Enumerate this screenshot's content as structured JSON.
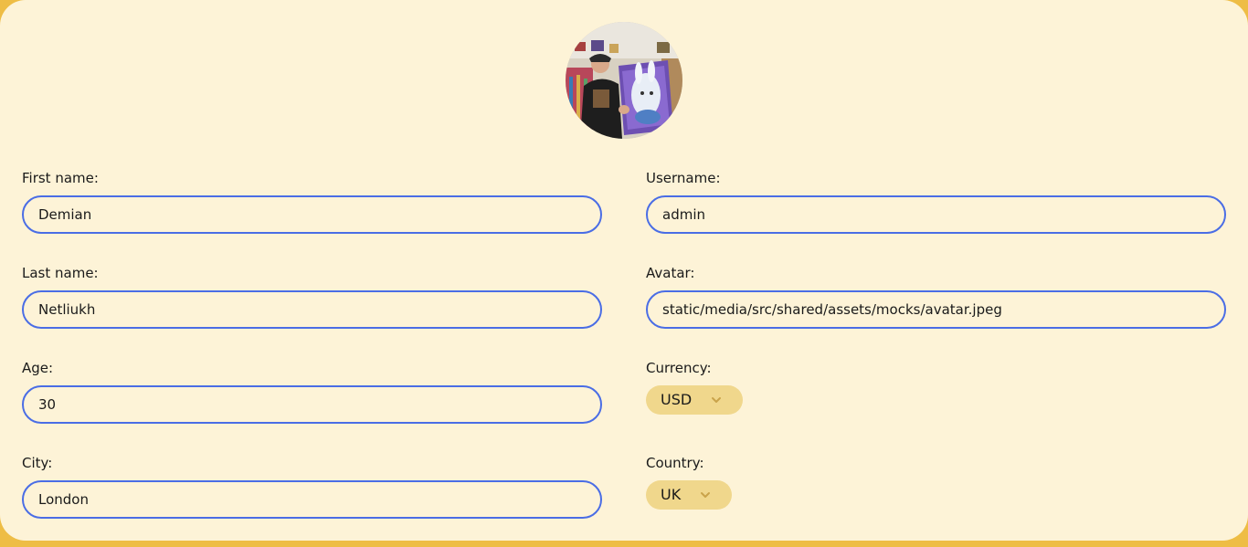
{
  "profile": {
    "avatar_icon": "user-photo-avatar",
    "fields": {
      "first_name": {
        "label": "First name:",
        "value": "Demian"
      },
      "last_name": {
        "label": "Last name:",
        "value": "Netliukh"
      },
      "age": {
        "label": "Age:",
        "value": "30"
      },
      "city": {
        "label": "City:",
        "value": "London"
      },
      "username": {
        "label": "Username:",
        "value": "admin"
      },
      "avatar": {
        "label": "Avatar:",
        "value": "static/media/src/shared/assets/mocks/avatar.jpeg"
      },
      "currency": {
        "label": "Currency:",
        "value": "USD"
      },
      "country": {
        "label": "Country:",
        "value": "UK"
      }
    }
  },
  "colors": {
    "background": "#fdf3d7",
    "outer": "#eebd45",
    "input_border": "#4a6de5",
    "select_bg": "#f0d78c"
  }
}
